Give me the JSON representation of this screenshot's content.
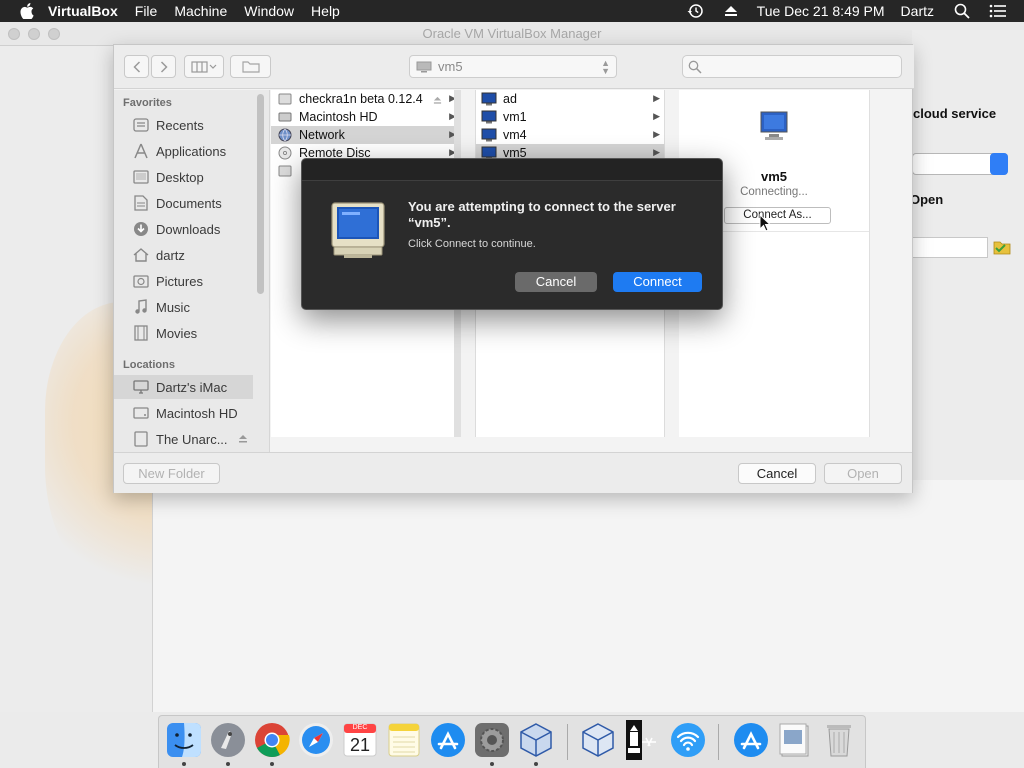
{
  "menubar": {
    "app": "VirtualBox",
    "items": [
      "File",
      "Machine",
      "Window",
      "Help"
    ],
    "clock": "Tue Dec 21  8:49 PM",
    "user": "Dartz"
  },
  "vbox": {
    "title": "Oracle VM VirtualBox Manager",
    "right_heading": "cloud service",
    "right_open": "Open"
  },
  "panel": {
    "location": "vm5",
    "sidebar": {
      "favorites_heading": "Favorites",
      "favorites": [
        "Recents",
        "Applications",
        "Desktop",
        "Documents",
        "Downloads",
        "dartz",
        "Pictures",
        "Music",
        "Movies"
      ],
      "locations_heading": "Locations",
      "locations": [
        "Dartz's iMac",
        "Macintosh HD",
        "The Unarc..."
      ]
    },
    "col1": [
      "checkra1n beta 0.12.4",
      "Macintosh HD",
      "Network",
      "Remote Disc"
    ],
    "col2": [
      "ad",
      "vm1",
      "vm4",
      "vm5"
    ],
    "preview": {
      "name": "vm5",
      "status": "Connecting...",
      "connect_as": "Connect As..."
    },
    "new_folder": "New Folder",
    "cancel": "Cancel",
    "open": "Open"
  },
  "dialog": {
    "title": "You are attempting to connect to the server “vm5”.",
    "body": "Click Connect to continue.",
    "cancel": "Cancel",
    "connect": "Connect"
  },
  "dock": {
    "icons": [
      "finder-icon",
      "launchpad-icon",
      "chrome-icon",
      "safari-icon",
      "calendar-icon",
      "notes-icon",
      "app-store-icon",
      "system-preferences-icon",
      "virtualbox-icon",
      "virtualbox-vm-icon",
      "checkra1n-icon",
      "wifi-icon",
      "app-store-download-icon",
      "preview-icon",
      "trash-icon"
    ],
    "calendar_month": "DEC",
    "calendar_day": "21"
  }
}
